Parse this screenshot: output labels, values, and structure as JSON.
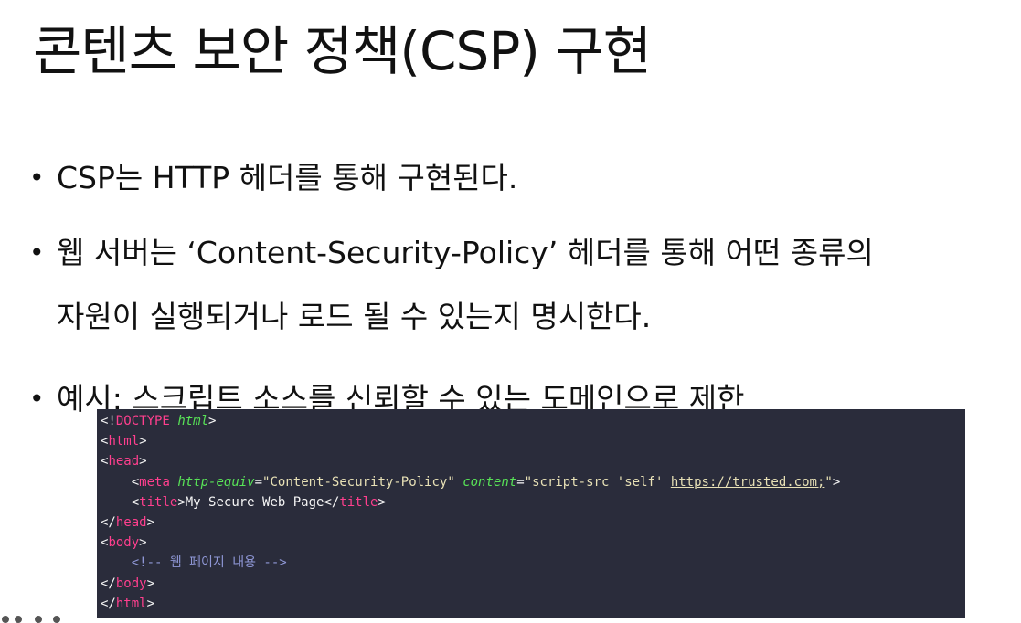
{
  "slide": {
    "title": "콘텐츠 보안 정책(CSP) 구현",
    "bullet_glyph": "•",
    "bullets": [
      {
        "text": "CSP는 HTTP 헤더를 통해 구현된다."
      },
      {
        "text": "웹 서버는 ‘Content-Security-Policy’ 헤더를 통해 어떤 종류의",
        "cont": "자원이 실행되거나 로드 될 수 있는지 명시한다."
      },
      {
        "text": "예시: 스크립트 소스를 신뢰할 수 있는 도메인으로 제한"
      }
    ]
  },
  "code": {
    "l1": {
      "open": "<!",
      "kw": "DOCTYPE",
      "sp": " ",
      "attr": "html",
      "close": ">"
    },
    "l2": {
      "open": "<",
      "tag": "html",
      "close": ">"
    },
    "l3": {
      "open": "<",
      "tag": "head",
      "close": ">"
    },
    "l4": {
      "indent": "    ",
      "open": "<",
      "tag": "meta",
      "attr1": "http-equiv",
      "eq1": "=",
      "val1": "\"Content-Security-Policy\"",
      "attr2": "content",
      "eq2": "=",
      "val2a": "\"script-src 'self' ",
      "url": "https://trusted.com;",
      "val2b": "\"",
      "close": ">"
    },
    "l5": {
      "indent": "    ",
      "open": "<",
      "tag": "title",
      "close": ">",
      "text": "My Secure Web Page",
      "endopen": "</",
      "endtag": "title",
      "endclose": ">"
    },
    "l6": {
      "open": "</",
      "tag": "head",
      "close": ">"
    },
    "l7": {
      "open": "<",
      "tag": "body",
      "close": ">"
    },
    "l8": {
      "indent": "    ",
      "comment": "<!-- 웹 페이지 내용 -->"
    },
    "l9": {
      "open": "</",
      "tag": "body",
      "close": ">"
    },
    "l10": {
      "open": "</",
      "tag": "html",
      "close": ">"
    }
  },
  "colors": {
    "code_bg": "#2a2c3b",
    "tag": "#ff3f8e",
    "attr": "#58e257",
    "string": "#e8e1b6",
    "comment": "#8f97d6"
  }
}
